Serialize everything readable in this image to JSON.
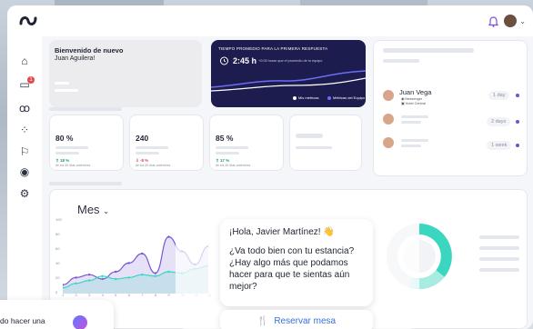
{
  "welcome": {
    "title": "Bienvenido de nuevo",
    "name": "Juan Aguilera!"
  },
  "response_time": {
    "title": "TIEMPO PROMEDIO PARA LA PRIMERA RESPUESTA",
    "value": "2:45 h",
    "subtitle": "+0:05 horas que el promedio de tu equipo",
    "legend_mine": "Mis métricas",
    "legend_team": "Métricas del Equipo",
    "colors": {
      "bg": "#1c1c4e",
      "line": "#ffffff",
      "team": "#6c6cf5"
    }
  },
  "contacts": [
    {
      "name": "Juan Vega",
      "channel": "Messenger",
      "property": "Hotel Central",
      "time": "1 day"
    },
    {
      "name": "",
      "time": "2 days"
    },
    {
      "name": "",
      "time": "1 week"
    }
  ],
  "stats": [
    {
      "value": "80 %",
      "change": "18 %",
      "sub": "de los 30 días anteriores",
      "color": "#1aa06d"
    },
    {
      "value": "240",
      "change": "-8 %",
      "sub": "de los 30 días anteriores",
      "color": "#e5484d"
    },
    {
      "value": "85 %",
      "change": "17 %",
      "sub": "de los 30 días anteriores",
      "color": "#1aa06d"
    }
  ],
  "chart_data": {
    "type": "line",
    "title": "Mes",
    "yticks": [
      "100",
      "80",
      "60",
      "40",
      "20",
      "0"
    ],
    "x": [
      "1",
      "2",
      "3",
      "4",
      "5",
      "6",
      "7",
      "8",
      "9",
      "10",
      "11",
      "12"
    ],
    "series": [
      {
        "values": [
          12,
          22,
          26,
          20,
          30,
          42,
          55,
          28,
          78,
          58,
          40,
          65
        ]
      },
      {
        "values": [
          8,
          14,
          18,
          24,
          20,
          22,
          26,
          24,
          30,
          28,
          34,
          38
        ]
      }
    ],
    "colors": [
      "#7a57d1",
      "#3ad6c0"
    ],
    "ylim": [
      0,
      100
    ]
  },
  "chat": {
    "greeting": "¡Hola, Javier Martínez! 👋",
    "message": "¿Va todo bien con tu estancia? ¿Hay algo más que podamos hacer para que te sientas aún mejor?",
    "button": "Reservar mesa"
  },
  "bottom_card": {
    "text": "do hacer una"
  },
  "icons": [
    "home-icon",
    "chat-icon",
    "users-icon",
    "apps-icon",
    "flag-icon",
    "palette-icon",
    "settings-icon",
    "bell-icon",
    "messenger-icon",
    "cutlery-icon"
  ]
}
